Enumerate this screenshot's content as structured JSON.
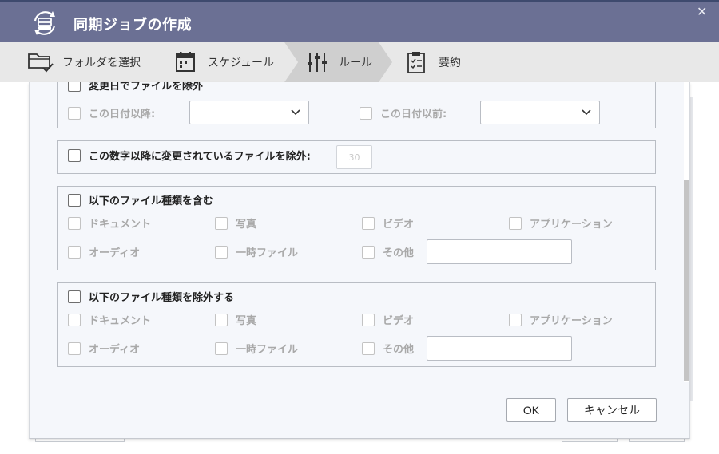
{
  "dialog": {
    "title": "同期ジョブの作成",
    "icon": "sync-drive-icon"
  },
  "steps": [
    {
      "label": "フォルダを選択",
      "icon": "folder-check-icon"
    },
    {
      "label": "スケジュール",
      "icon": "calendar-icon"
    },
    {
      "label": "ルール",
      "icon": "sliders-icon",
      "active": true
    },
    {
      "label": "要約",
      "icon": "clipboard-icon"
    }
  ],
  "date_group": {
    "header_label": "変更日でファイルを除外",
    "after_label": "この日付以降:",
    "after_value": "",
    "before_label": "この日付以前:",
    "before_value": ""
  },
  "modified_group": {
    "label": "この数字以降に変更されているファイルを除外:",
    "placeholder": "30"
  },
  "include_group": {
    "header_label": "以下のファイル種類を含む",
    "types": [
      "ドキュメント",
      "写真",
      "ビデオ",
      "アプリケーション",
      "オーディオ",
      "一時ファイル",
      "その他"
    ],
    "other_value": ""
  },
  "exclude_group": {
    "header_label": "以下のファイル種類を除外する",
    "types": [
      "ドキュメント",
      "写真",
      "ビデオ",
      "アプリケーション",
      "オーディオ",
      "一時ファイル",
      "その他"
    ],
    "other_value": ""
  },
  "buttons": {
    "ok": "OK",
    "cancel": "キャンセル"
  },
  "colors": {
    "titlebar": "#6b7094",
    "stepbar": "#e8e8e8",
    "active_step": "#cfcfcf",
    "panel": "#f5f7fb"
  }
}
